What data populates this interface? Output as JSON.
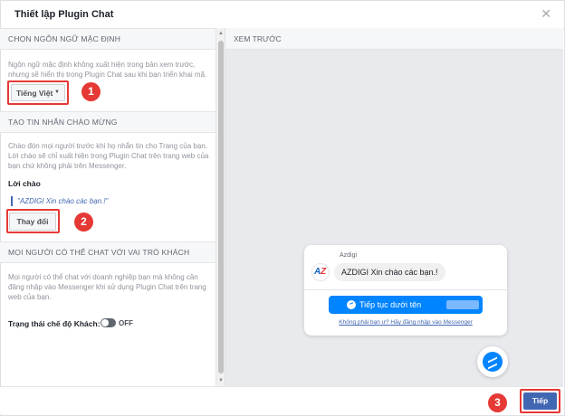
{
  "dialog": {
    "title": "Thiết lập Plugin Chat",
    "close_icon": "close-icon"
  },
  "left": {
    "language": {
      "heading": "CHỌN NGÔN NGỮ MẶC ĐỊNH",
      "description": "Ngôn ngữ mặc định không xuất hiện trong bản xem trước, nhưng sẽ hiển thị trong Plugin Chat sau khi bạn triển khai mã.",
      "selected": "Tiếng Việt"
    },
    "greeting": {
      "heading": "TẠO TIN NHẮN CHÀO MỪNG",
      "description": "Chào đón mọi người trước khi họ nhắn tin cho Trang của bạn. Lời chào sẽ chỉ xuất hiện trong Plugin Chat trên trang web của bạn chứ không phải trên Messenger.",
      "label": "Lời chào",
      "text": "\"AZDIGI Xin chào các bạn.!\"",
      "change_button": "Thay đổi"
    },
    "guest": {
      "heading": "MỌI NGƯỜI CÓ THỂ CHAT VỚI VAI TRÒ KHÁCH",
      "description": "Mọi người có thể chat với doanh nghiệp bạn mà không cần đăng nhập vào Messenger khi sử dụng Plugin Chat trên trang web của bạn.",
      "toggle_label": "Trạng thái chế độ Khách:",
      "toggle_state": "OFF"
    }
  },
  "preview": {
    "heading": "XEM TRƯỚC",
    "page_name": "Azdigi",
    "avatar_a": "A",
    "avatar_z": "Z",
    "message": "AZDIGI Xin chào các bạn.!",
    "continue_label": "Tiếp tục dưới tên",
    "not_you": "Không phải bạn ư? Hãy đăng nhập vào Messenger"
  },
  "annotations": [
    "1",
    "2",
    "3"
  ],
  "footer": {
    "next_button": "Tiếp"
  },
  "colors": {
    "accent": "#4267b2",
    "messenger": "#0084ff",
    "annotation": "#e53935"
  }
}
